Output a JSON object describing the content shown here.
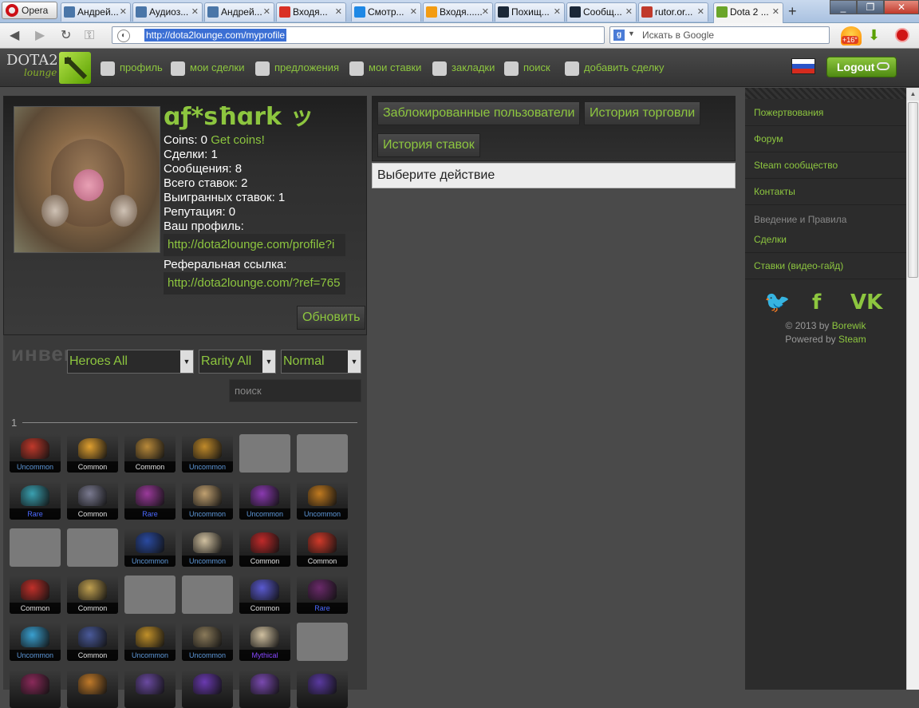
{
  "browser": {
    "menu_label": "Opera",
    "tabs": [
      {
        "label": "Андрей...",
        "color": "#4a76a8"
      },
      {
        "label": "Аудиоз...",
        "color": "#4a76a8"
      },
      {
        "label": "Андрей...",
        "color": "#4a76a8"
      },
      {
        "label": "Входя...",
        "color": "#d93025"
      },
      {
        "label": "Смотр...",
        "color": "#1e88e5"
      },
      {
        "label": "Входя......",
        "color": "#f39c12"
      },
      {
        "label": "Похищ...",
        "color": "#1b2838"
      },
      {
        "label": "Сообщ...",
        "color": "#1b2838"
      },
      {
        "label": "rutor.or...",
        "color": "#c0392b"
      },
      {
        "label": "Dota 2 ...",
        "color": "#6aa52a"
      }
    ],
    "url": "http://dota2lounge.com/myprofile",
    "search_placeholder": "Искать в Google",
    "weather": "+16°"
  },
  "site": {
    "logo_text": "DOTA2",
    "logo_sub": "lounge",
    "nav": [
      {
        "label": "профиль",
        "icon": "user-icon"
      },
      {
        "label": "мои сделки",
        "icon": "trade-arrows-icon"
      },
      {
        "label": "предложения",
        "icon": "tag-icon"
      },
      {
        "label": "мои ставки",
        "icon": "dice-icon"
      },
      {
        "label": "закладки",
        "icon": "star-icon"
      },
      {
        "label": "поиск",
        "icon": "magnifier-icon"
      },
      {
        "label": "добавить сделку",
        "icon": "plus-circle-icon"
      }
    ],
    "logout_label": "Logout",
    "accent": "#8dc63f"
  },
  "profile": {
    "name": "ɑƒ*sħɑrk ッ",
    "coins_label": "Coins: 0",
    "get_coins": "Get coins!",
    "trades": "Сделки: 1",
    "messages": "Сообщения: 8",
    "total_bets": "Всего ставок: 2",
    "won_bets": "Выигранных ставок: 1",
    "reputation": "Репутация: 0",
    "profile_label": "Ваш профиль:",
    "profile_link": "http://dota2lounge.com/profile?i",
    "referral_label": "Реферальная ссылка:",
    "referral_link": "http://dota2lounge.com/?ref=765",
    "refresh_button": "Обновить"
  },
  "inventory": {
    "title": "инвентарь",
    "filter_heroes": "Heroes All",
    "filter_rarity": "Rarity All",
    "filter_quality": "Normal",
    "search_placeholder": "поиск",
    "page": "1",
    "rarity_colors": {
      "Common": "#e0e0e0",
      "Uncommon": "#5e98d9",
      "Rare": "#4b69ff",
      "Mythical": "#8847ff"
    },
    "items": [
      {
        "rarity": "Uncommon",
        "color": "#c0392b"
      },
      {
        "rarity": "Common",
        "color": "#e0a030"
      },
      {
        "rarity": "Common",
        "color": "#b98a3a"
      },
      {
        "rarity": "Uncommon",
        "color": "#c08a2a"
      },
      {
        "rarity": ""
      },
      {
        "rarity": ""
      },
      {
        "rarity": "Rare",
        "color": "#3aa0b0"
      },
      {
        "rarity": "Common",
        "color": "#7a7a90"
      },
      {
        "rarity": "Rare",
        "color": "#9a3a9a"
      },
      {
        "rarity": "Uncommon",
        "color": "#c0a070"
      },
      {
        "rarity": "Uncommon",
        "color": "#8a3ab0"
      },
      {
        "rarity": "Uncommon",
        "color": "#c07a20"
      },
      {
        "rarity": ""
      },
      {
        "rarity": ""
      },
      {
        "rarity": "Uncommon",
        "color": "#2a4aa0"
      },
      {
        "rarity": "Uncommon",
        "color": "#d0c0a0"
      },
      {
        "rarity": "Common",
        "color": "#c02a2a"
      },
      {
        "rarity": "Common",
        "color": "#d03a2a"
      },
      {
        "rarity": "Common",
        "color": "#c0302a"
      },
      {
        "rarity": "Common",
        "color": "#c0a050"
      },
      {
        "rarity": ""
      },
      {
        "rarity": ""
      },
      {
        "rarity": "Common",
        "color": "#5a5ad0"
      },
      {
        "rarity": "Rare",
        "color": "#6a2a6a"
      },
      {
        "rarity": "Uncommon",
        "color": "#3aa0d0"
      },
      {
        "rarity": "Common",
        "color": "#4a5a9a"
      },
      {
        "rarity": "Uncommon",
        "color": "#c0902a"
      },
      {
        "rarity": "Uncommon",
        "color": "#8a7a5a"
      },
      {
        "rarity": "Mythical",
        "color": "#d0c0a0"
      },
      {
        "rarity": ""
      },
      {
        "rarity": "",
        "color": "#8a2a5a"
      },
      {
        "rarity": "",
        "color": "#c07a2a"
      },
      {
        "rarity": "",
        "color": "#6a4aa0"
      },
      {
        "rarity": "",
        "color": "#6a3ab0"
      },
      {
        "rarity": "",
        "color": "#7a4ab0"
      },
      {
        "rarity": "",
        "color": "#5a3aa0"
      }
    ]
  },
  "actions": {
    "blocked_users": "Заблокированные пользователи",
    "trade_history": "История торговли",
    "bet_history": "История ставок",
    "choose_action": "Выберите действие"
  },
  "sidebar": {
    "donations": "Пожертвования",
    "forum": "Форум",
    "steam_community": "Steam сообщество",
    "contacts": "Контакты",
    "intro_heading": "Введение и Правила",
    "trades": "Сделки",
    "bets_guide": "Ставки (видео-гайд)",
    "copyright": "© 2013 by",
    "author": "Borewik",
    "powered": "Powered by",
    "powered_link": "Steam"
  }
}
